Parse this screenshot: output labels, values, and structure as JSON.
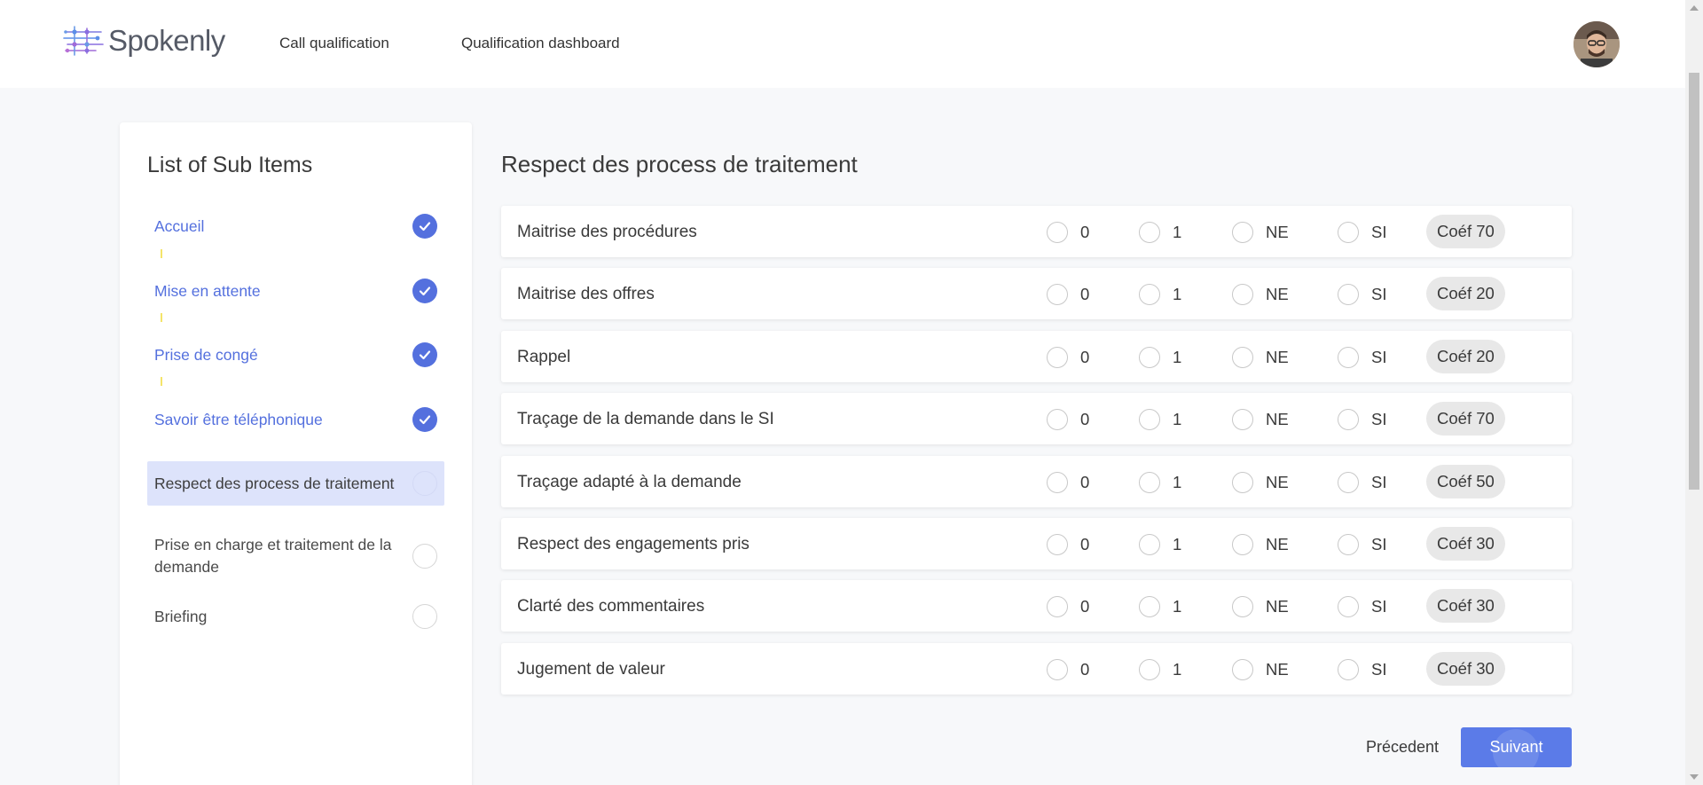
{
  "header": {
    "brand": "Spokenly",
    "nav": [
      {
        "label": "Call qualification"
      },
      {
        "label": "Qualification dashboard"
      }
    ]
  },
  "sidebar": {
    "title": "List of Sub Items",
    "items": [
      {
        "label": "Accueil",
        "status": "done"
      },
      {
        "label": "Mise en attente",
        "status": "done"
      },
      {
        "label": "Prise de congé",
        "status": "done"
      },
      {
        "label": "Savoir être téléphonique",
        "status": "done"
      },
      {
        "label": "Respect des process de traitement",
        "status": "active"
      },
      {
        "label": "Prise en charge et traitement de la demande",
        "status": "pending"
      },
      {
        "label": "Briefing",
        "status": "pending"
      }
    ]
  },
  "main": {
    "title": "Respect des process de traitement",
    "options": [
      "0",
      "1",
      "NE",
      "SI"
    ],
    "criteria": [
      {
        "label": "Maitrise des procédures",
        "coef": "Coéf 70"
      },
      {
        "label": "Maitrise des offres",
        "coef": "Coéf 20"
      },
      {
        "label": "Rappel",
        "coef": "Coéf 20"
      },
      {
        "label": "Traçage de la demande dans le SI",
        "coef": "Coéf 70"
      },
      {
        "label": "Traçage adapté à la demande",
        "coef": "Coéf 50"
      },
      {
        "label": "Respect des engagements pris",
        "coef": "Coéf 30"
      },
      {
        "label": "Clarté des commentaires",
        "coef": "Coéf 30"
      },
      {
        "label": "Jugement de valeur",
        "coef": "Coéf 30"
      }
    ]
  },
  "footer": {
    "prev_label": "Précedent",
    "next_label": "Suivant"
  },
  "colors": {
    "accent": "#5470de",
    "button": "#5b7be8",
    "active_bg": "#dde3fb"
  }
}
